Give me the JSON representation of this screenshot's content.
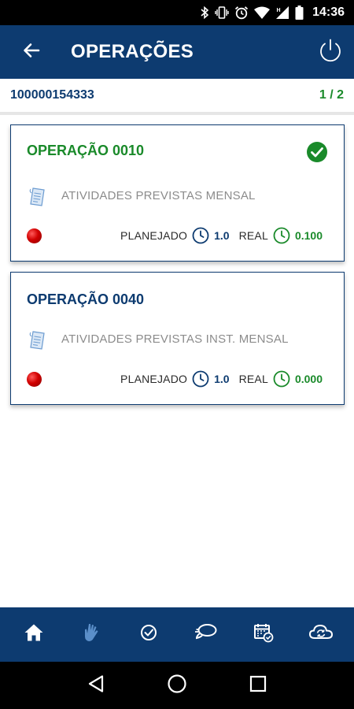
{
  "status_bar": {
    "time": "14:36",
    "icons": [
      "bluetooth-icon",
      "vibrate-icon",
      "alarm-icon",
      "wifi-icon",
      "signal-icon",
      "battery-icon"
    ]
  },
  "app_bar": {
    "title": "OPERAÇÕES",
    "back_icon": "arrow-left-icon",
    "power_icon": "power-icon"
  },
  "sub_header": {
    "order_id": "100000154333",
    "pager": "1 / 2"
  },
  "operations": [
    {
      "title": "OPERAÇÃO 0010",
      "title_color": "#1a8a2a",
      "completed": true,
      "description": "ATIVIDADES PREVISTAS MENSAL",
      "status_color": "#d10000",
      "planned_label": "PLANEJADO",
      "planned_value": "1.0",
      "real_label": "REAL",
      "real_value": "0.100"
    },
    {
      "title": "OPERAÇÃO 0040",
      "title_color": "#0d3b70",
      "completed": false,
      "description": "ATIVIDADES PREVISTAS INST. MENSAL",
      "status_color": "#d10000",
      "planned_label": "PLANEJADO",
      "planned_value": "1.0",
      "real_label": "REAL",
      "real_value": "0.000"
    }
  ],
  "bottom_nav": {
    "items": [
      "home-icon",
      "hand-icon",
      "check-circle-icon",
      "chat-icon",
      "calendar-check-icon",
      "cloud-sync-icon"
    ],
    "active": "home-icon"
  },
  "colors": {
    "primary": "#0d3b70",
    "success": "#1a8a2a",
    "muted_text": "#8c8c8c",
    "inactive_nav_icon": "#5b8fc9"
  }
}
